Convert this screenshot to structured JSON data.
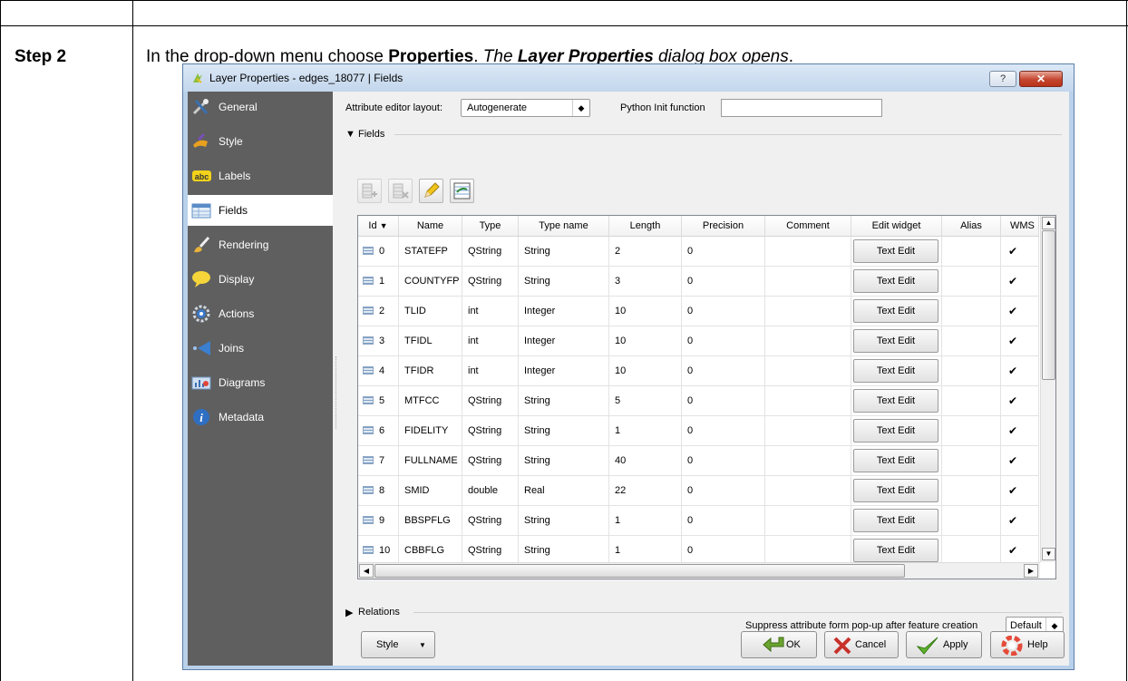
{
  "doc": {
    "step_label": "Step 2",
    "instr_prefix": "In the drop-down menu choose ",
    "instr_bold": "Properties",
    "instr_mid": ". ",
    "instr_italic1": "The ",
    "instr_bolditalic": "Layer Properties",
    "instr_italic2": " dialog box opens",
    "instr_end": "."
  },
  "window": {
    "title": "Layer Properties - edges_18077 | Fields",
    "help_label": "?",
    "close_label": "✕"
  },
  "sidebar": {
    "items": [
      {
        "label": "General",
        "icon": "tools-icon"
      },
      {
        "label": "Style",
        "icon": "brush-icon"
      },
      {
        "label": "Labels",
        "icon": "abc-icon"
      },
      {
        "label": "Fields",
        "icon": "table-icon"
      },
      {
        "label": "Rendering",
        "icon": "paintbrush-icon"
      },
      {
        "label": "Display",
        "icon": "speech-bubble-icon"
      },
      {
        "label": "Actions",
        "icon": "gear-icon"
      },
      {
        "label": "Joins",
        "icon": "join-arrow-icon"
      },
      {
        "label": "Diagrams",
        "icon": "diagram-icon"
      },
      {
        "label": "Metadata",
        "icon": "info-icon"
      }
    ],
    "active": "Fields"
  },
  "form": {
    "layout_label": "Attribute editor layout:",
    "layout_value": "Autogenerate",
    "python_label": "Python Init function",
    "python_value": "",
    "fields_group": "Fields",
    "relations_group": "Relations",
    "suppress_label": "Suppress attribute form pop-up after feature creation",
    "suppress_value": "Default"
  },
  "table": {
    "headers": [
      "Id",
      "Name",
      "Type",
      "Type name",
      "Length",
      "Precision",
      "Comment",
      "Edit widget",
      "Alias",
      "WMS"
    ],
    "rows": [
      {
        "id": "0",
        "name": "STATEFP",
        "type": "QString",
        "type_name": "String",
        "length": "2",
        "precision": "0",
        "comment": "",
        "widget": "Text Edit",
        "alias": "",
        "wms": "✔"
      },
      {
        "id": "1",
        "name": "COUNTYFP",
        "type": "QString",
        "type_name": "String",
        "length": "3",
        "precision": "0",
        "comment": "",
        "widget": "Text Edit",
        "alias": "",
        "wms": "✔"
      },
      {
        "id": "2",
        "name": "TLID",
        "type": "int",
        "type_name": "Integer",
        "length": "10",
        "precision": "0",
        "comment": "",
        "widget": "Text Edit",
        "alias": "",
        "wms": "✔"
      },
      {
        "id": "3",
        "name": "TFIDL",
        "type": "int",
        "type_name": "Integer",
        "length": "10",
        "precision": "0",
        "comment": "",
        "widget": "Text Edit",
        "alias": "",
        "wms": "✔"
      },
      {
        "id": "4",
        "name": "TFIDR",
        "type": "int",
        "type_name": "Integer",
        "length": "10",
        "precision": "0",
        "comment": "",
        "widget": "Text Edit",
        "alias": "",
        "wms": "✔"
      },
      {
        "id": "5",
        "name": "MTFCC",
        "type": "QString",
        "type_name": "String",
        "length": "5",
        "precision": "0",
        "comment": "",
        "widget": "Text Edit",
        "alias": "",
        "wms": "✔"
      },
      {
        "id": "6",
        "name": "FIDELITY",
        "type": "QString",
        "type_name": "String",
        "length": "1",
        "precision": "0",
        "comment": "",
        "widget": "Text Edit",
        "alias": "",
        "wms": "✔"
      },
      {
        "id": "7",
        "name": "FULLNAME",
        "type": "QString",
        "type_name": "String",
        "length": "40",
        "precision": "0",
        "comment": "",
        "widget": "Text Edit",
        "alias": "",
        "wms": "✔"
      },
      {
        "id": "8",
        "name": "SMID",
        "type": "double",
        "type_name": "Real",
        "length": "22",
        "precision": "0",
        "comment": "",
        "widget": "Text Edit",
        "alias": "",
        "wms": "✔"
      },
      {
        "id": "9",
        "name": "BBSPFLG",
        "type": "QString",
        "type_name": "String",
        "length": "1",
        "precision": "0",
        "comment": "",
        "widget": "Text Edit",
        "alias": "",
        "wms": "✔"
      },
      {
        "id": "10",
        "name": "CBBFLG",
        "type": "QString",
        "type_name": "String",
        "length": "1",
        "precision": "0",
        "comment": "",
        "widget": "Text Edit",
        "alias": "",
        "wms": "✔"
      }
    ]
  },
  "buttons": {
    "style": "Style",
    "ok": "OK",
    "cancel": "Cancel",
    "apply": "Apply",
    "help": "Help"
  }
}
